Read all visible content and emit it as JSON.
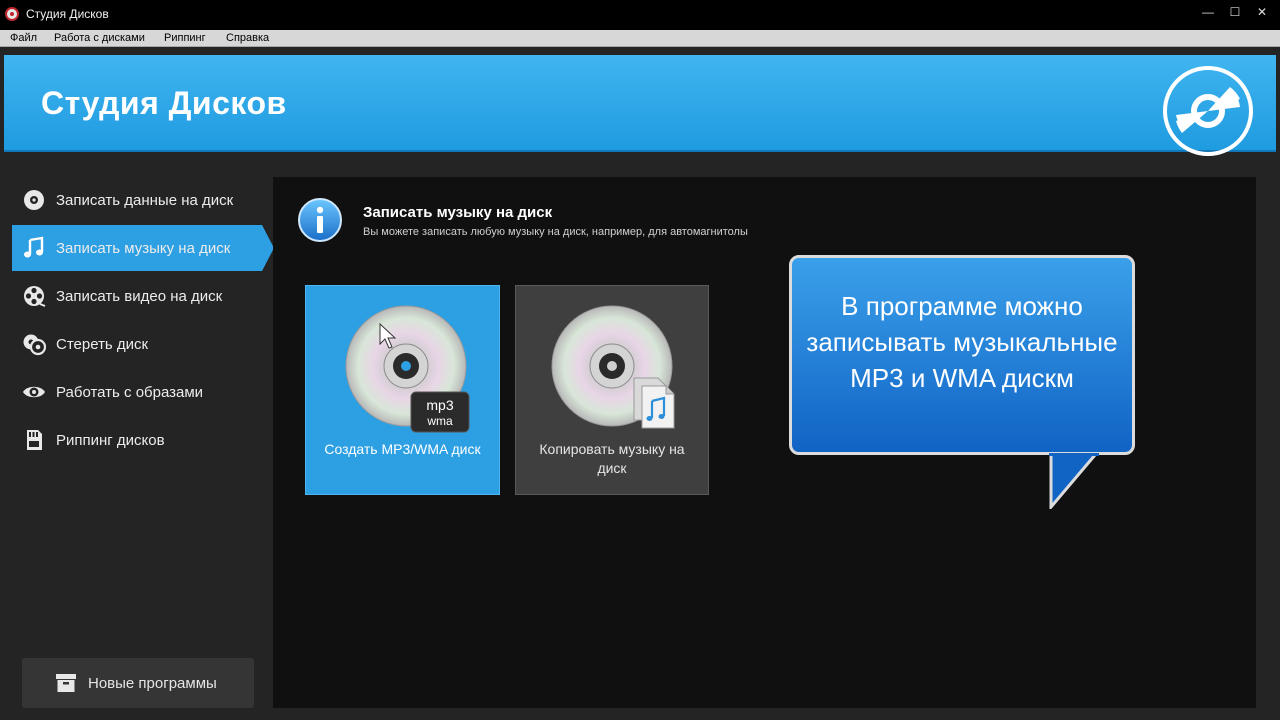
{
  "window": {
    "title": "Студия Дисков",
    "min_glyph": "—",
    "max_glyph": "☐",
    "close_glyph": "✕"
  },
  "menu": [
    "Файл",
    "Работа с дисками",
    "Риппинг",
    "Справка"
  ],
  "banner": {
    "title": "Студия Дисков",
    "icon": "disc-logo-icon"
  },
  "sidebar": {
    "items": [
      {
        "label": "Записать данные на диск",
        "icon": "data-disc-icon",
        "active": false
      },
      {
        "label": "Записать музыку на диск",
        "icon": "music-note-icon",
        "active": true
      },
      {
        "label": "Записать видео на диск",
        "icon": "film-reel-icon",
        "active": false
      },
      {
        "label": "Стереть диск",
        "icon": "erase-disc-icon",
        "active": false
      },
      {
        "label": "Работать с образами",
        "icon": "eye-icon",
        "active": false
      },
      {
        "label": "Риппинг дисков",
        "icon": "sd-card-icon",
        "active": false
      }
    ],
    "new_programs": "Новые программы"
  },
  "main": {
    "title": "Записать музыку на диск",
    "subtitle": "Вы можете записать любую музыку на диск, например, для автомагнитолы",
    "tiles": [
      {
        "label": "Создать MP3/WMA диск",
        "badge_top": "mp3",
        "badge_bottom": "wma",
        "selected": true
      },
      {
        "label": "Копировать музыку на диск",
        "selected": false
      }
    ]
  },
  "callout": {
    "text": "В программе можно записывать музыкальные MP3 и WMA дискм"
  },
  "colors": {
    "accent": "#2d9fe3",
    "banner": "#33aef0",
    "background": "#242424",
    "panel": "#101010"
  }
}
